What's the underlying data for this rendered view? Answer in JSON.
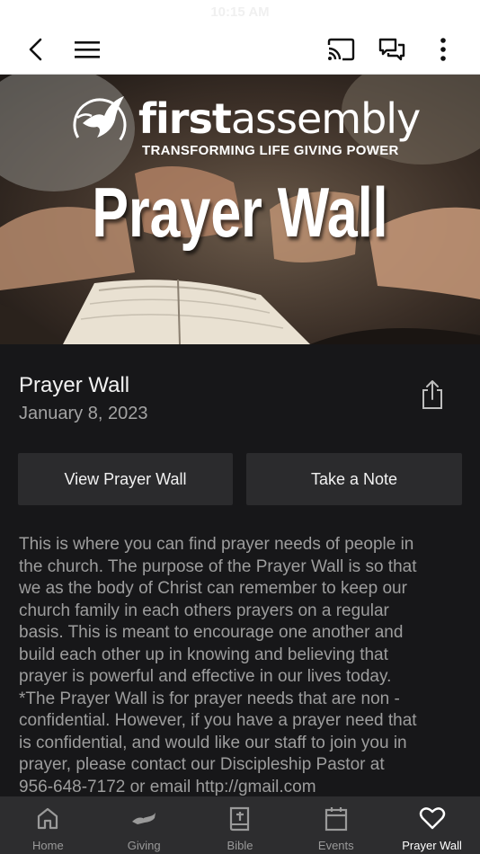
{
  "status_bar": {
    "time": "10:15 AM"
  },
  "toolbar": {
    "back": "back-arrow-icon",
    "menu": "hamburger-menu-icon",
    "cast": "cast-icon",
    "chat": "chat-bubbles-icon",
    "more": "more-vertical-icon"
  },
  "hero": {
    "brand_bold": "first",
    "brand_regular": "assembly",
    "tagline": "TRANSFORMING LIFE GIVING POWER",
    "title": "Prayer Wall"
  },
  "item": {
    "title": "Prayer Wall",
    "date": "January 8, 2023",
    "share_icon": "share-icon"
  },
  "actions": {
    "view_label": "View Prayer Wall",
    "note_label": "Take a Note"
  },
  "body_lines": [
    "This is where you can find prayer needs of people in",
    "the church. The purpose of the Prayer Wall is so that",
    "we as the body of Christ can remember to keep our",
    "church family in each others prayers on a regular",
    "basis. This is meant to encourage one another and",
    "build each other up in knowing and believing that",
    "prayer is powerful and effective in our lives today.",
    "*The Prayer Wall is for prayer needs that are non -",
    "confidential. However, if you have a prayer need that",
    "is confidential, and would like our staff to join you in",
    "prayer, please contact our Discipleship Pastor at",
    "956-648-7172 or email http://gmail.com"
  ],
  "tabs": [
    {
      "label": "Home",
      "icon": "home-icon"
    },
    {
      "label": "Giving",
      "icon": "giving-hand-icon"
    },
    {
      "label": "Bible",
      "icon": "bible-icon"
    },
    {
      "label": "Events",
      "icon": "calendar-icon"
    },
    {
      "label": "Prayer Wall",
      "icon": "heart-icon"
    }
  ],
  "colors": {
    "background": "#171719",
    "button": "#2b2b2d",
    "tabbar": "#2d2d2f",
    "text_muted": "#9d9d9d",
    "active_tab": "#ffffff"
  }
}
